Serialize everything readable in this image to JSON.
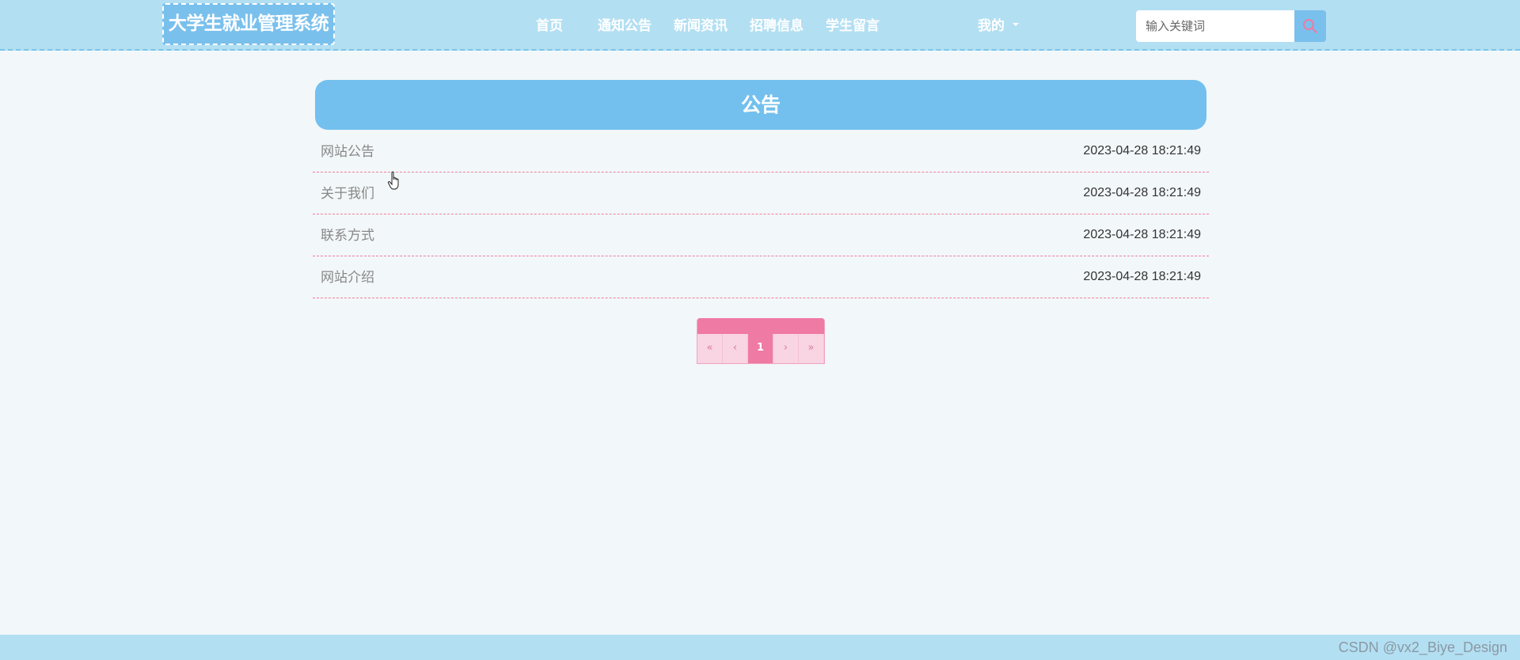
{
  "header": {
    "logo": "大学生就业管理系统",
    "nav": {
      "home": "首页",
      "notice": "通知公告",
      "news": "新闻资讯",
      "jobs": "招聘信息",
      "messages": "学生留言",
      "mine": "我的"
    },
    "search": {
      "placeholder": "输入关键词",
      "icon": "search-icon"
    },
    "colors": {
      "header_bg": "#b3dff2",
      "accent_blue": "#73c0ee",
      "accent_pink": "#ef7aa4"
    }
  },
  "main": {
    "title": "公告",
    "items": [
      {
        "title": "网站公告",
        "date": "2023-04-28 18:21:49"
      },
      {
        "title": "关于我们",
        "date": "2023-04-28 18:21:49"
      },
      {
        "title": "联系方式",
        "date": "2023-04-28 18:21:49"
      },
      {
        "title": "网站介绍",
        "date": "2023-04-28 18:21:49"
      }
    ]
  },
  "pagination": {
    "first": "«",
    "prev": "‹",
    "current": "1",
    "next": "›",
    "last": "»"
  },
  "footer": {
    "watermark": "CSDN @vx2_Biye_Design"
  }
}
